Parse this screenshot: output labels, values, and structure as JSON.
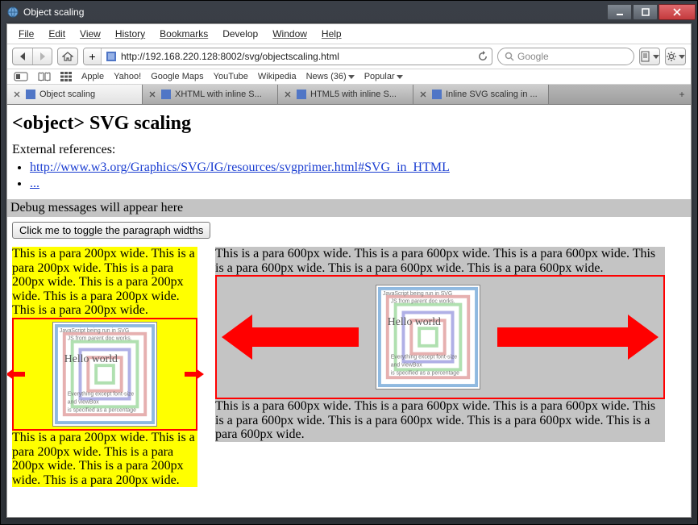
{
  "window": {
    "title": "Object scaling"
  },
  "menu": {
    "file": "File",
    "edit": "Edit",
    "view": "View",
    "history": "History",
    "bookmarks": "Bookmarks",
    "develop": "Develop",
    "window": "Window",
    "help": "Help"
  },
  "toolbar": {
    "url": "http://192.168.220.128:8002/svg/objectscaling.html",
    "search_placeholder": "Google"
  },
  "bookmarks_bar": {
    "apple": "Apple",
    "yahoo": "Yahoo!",
    "gmaps": "Google Maps",
    "youtube": "YouTube",
    "wikipedia": "Wikipedia",
    "news": "News (36)",
    "popular": "Popular"
  },
  "tabs": [
    {
      "label": "Object scaling",
      "active": true
    },
    {
      "label": "XHTML with inline S...",
      "active": false
    },
    {
      "label": "HTML5 with inline S...",
      "active": false
    },
    {
      "label": "Inline SVG scaling in ...",
      "active": false
    }
  ],
  "page": {
    "title": "<object> SVG scaling",
    "ext_refs_label": "External references:",
    "link1": "http://www.w3.org/Graphics/SVG/IG/resources/svgprimer.html#SVG_in_HTML",
    "link2": "...",
    "debug": "Debug messages will appear here",
    "button": "Click me to toggle the paragraph widths",
    "p200": "This is a para 200px wide. This is a para 200px wide. This is a para 200px wide. This is a para 200px wide. This is a para 200px wide. This is a para 200px wide.",
    "p200b": "This is a para 200px wide. This is a para 200px wide. This is a para 200px wide. This is a para 200px wide. This is a para 200px wide.",
    "p600": "This is a para 600px wide. This is a para 600px wide. This is a para 600px wide. This is a para 600px wide. This is a para 600px wide. This is a para 600px wide.",
    "p600b": "This is a para 600px wide. This is a para 600px wide. This is a para 600px wide. This is a para 600px wide. This is a para 600px wide. This is a para 600px wide. This is a para 600px wide."
  },
  "svg": {
    "l1": "JavaScript being run in SVG",
    "l2": "JS from parent doc works.",
    "title": "Hello world",
    "l3": "Everything except font-size",
    "l4": "and viewBox",
    "l5": "is specified as a percentage"
  }
}
